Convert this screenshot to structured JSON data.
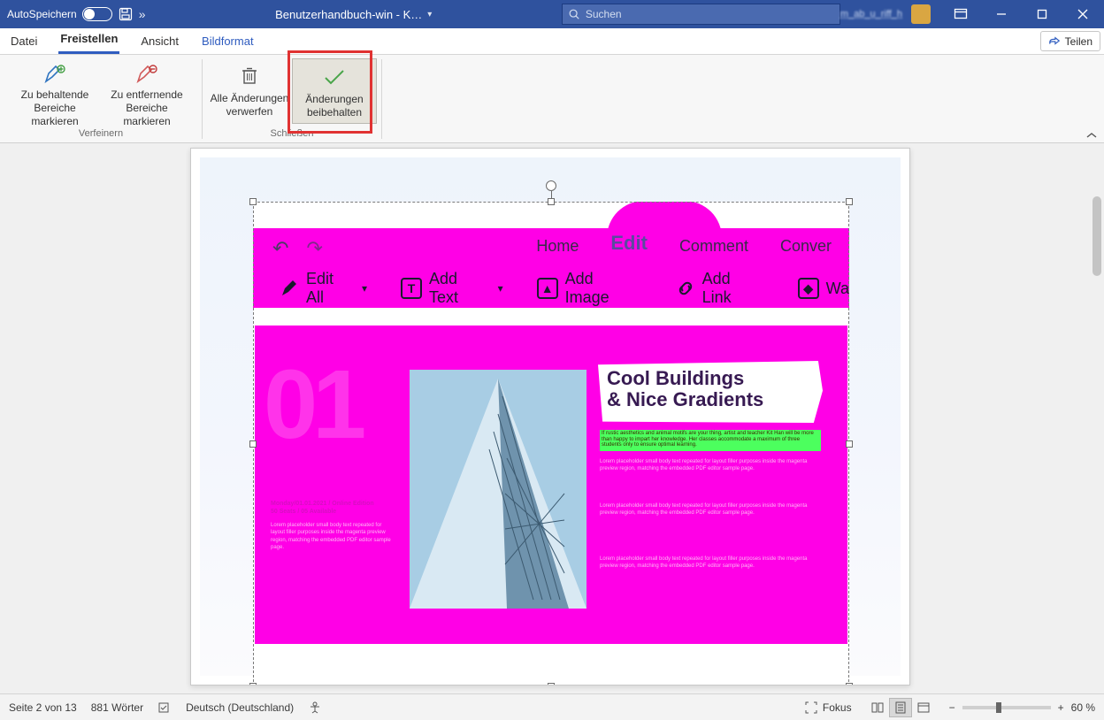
{
  "titlebar": {
    "autosave_label": "AutoSpeichern",
    "doc_title": "Benutzerhandbuch-win  -  K…",
    "search_placeholder": "Suchen",
    "user_name_blurred": "m_ab_u_riff_h"
  },
  "tabs": {
    "file": "Datei",
    "freistellen": "Freistellen",
    "ansicht": "Ansicht",
    "bildformat": "Bildformat",
    "share": "Teilen"
  },
  "ribbon": {
    "mark_keep": "Zu behaltende\nBereiche markieren",
    "mark_remove": "Zu entfernende\nBereiche markieren",
    "discard": "Alle Änderungen\nverwerfen",
    "keep": "Änderungen\nbeibehalten",
    "group_verfeinern": "Verfeinern",
    "group_schliessen": "Schließen"
  },
  "embedded": {
    "tabs": {
      "home": "Home",
      "edit": "Edit",
      "comment": "Comment",
      "convert": "Conver"
    },
    "toolbar": {
      "edit_all": "Edit All",
      "add_text": "Add Text",
      "add_image": "Add Image",
      "add_link": "Add Link",
      "watermark": "Wa"
    },
    "big01": "01",
    "heading_l1": "Cool Buildings",
    "heading_l2": "& Nice Gradients",
    "left_meta": "Monday/01.01.2021 / Online Edition\n50 Seats / 05 Available",
    "lorem_short": "If rustic aesthetics and animal motifs are your thing, artist and teacher Kit Han will be more than happy to impart her knowledge. Her classes accommodate a maximum of three students only to ensure optimal learning.",
    "lorem_tiny": "Lorem placeholder small body text repeated for layout filler purposes inside the magenta preview region, matching the embedded PDF editor sample page."
  },
  "statusbar": {
    "page": "Seite 2 von 13",
    "words": "881 Wörter",
    "language": "Deutsch (Deutschland)",
    "focus": "Fokus",
    "zoom_pct": "60 %"
  }
}
